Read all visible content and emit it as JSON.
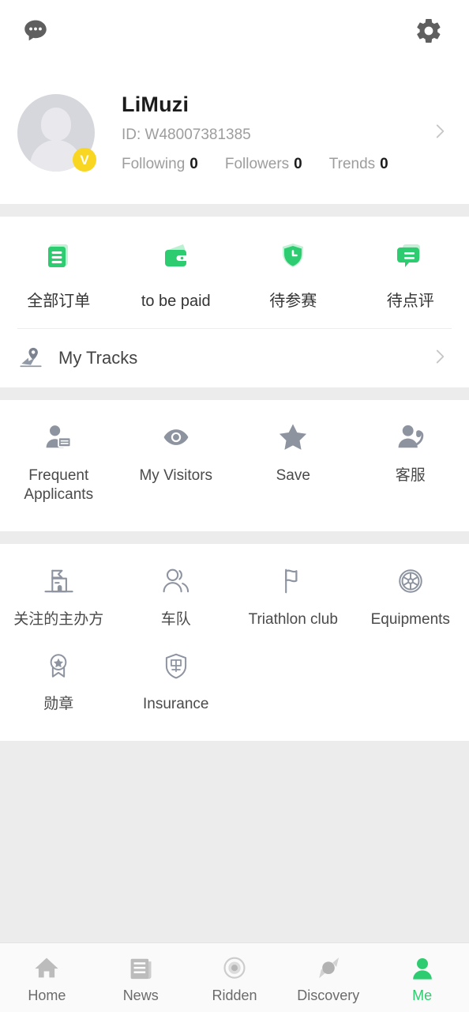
{
  "theme": {
    "accent_green": "#2ecc71",
    "badge_yellow": "#f8d621",
    "gray_icon": "#8d94a0",
    "page_bg": "#ececec"
  },
  "topbar": {
    "message_icon": "chat-bubble-icon",
    "settings_icon": "gear-icon"
  },
  "profile": {
    "name": "LiMuzi",
    "id": "ID: W48007381385",
    "verified_badge": "V",
    "avatar_icon": "default-avatar-placeholder",
    "chevron": "chevron-right-icon",
    "stats": [
      {
        "label": "Following",
        "value": "0"
      },
      {
        "label": "Followers",
        "value": "0"
      },
      {
        "label": "Trends",
        "value": "0"
      }
    ]
  },
  "orders": {
    "items": [
      {
        "label": "全部订单",
        "icon": "document-list-icon"
      },
      {
        "label": "to be paid",
        "icon": "wallet-icon"
      },
      {
        "label": "待参赛",
        "icon": "shield-clock-icon"
      },
      {
        "label": "待点评",
        "icon": "comment-bubble-icon"
      }
    ]
  },
  "tracks": {
    "label": "My Tracks",
    "icon": "map-pin-route-icon",
    "chevron": "chevron-right-icon"
  },
  "services": {
    "items": [
      {
        "label": "Frequent Applicants",
        "icon": "person-id-card-icon"
      },
      {
        "label": "My Visitors",
        "icon": "eye-icon"
      },
      {
        "label": "Save",
        "icon": "star-icon"
      },
      {
        "label": "客服",
        "icon": "person-headset-icon"
      }
    ]
  },
  "community": {
    "items": [
      {
        "label": "关注的主办方",
        "icon": "building-flag-icon"
      },
      {
        "label": "车队",
        "icon": "people-group-icon"
      },
      {
        "label": "Triathlon club",
        "icon": "flag-icon"
      },
      {
        "label": "Equipments",
        "icon": "bike-wheel-icon"
      },
      {
        "label": "勋章",
        "icon": "medal-badge-icon"
      },
      {
        "label": "Insurance",
        "icon": "shield-insurance-icon"
      }
    ]
  },
  "bottom_nav": {
    "items": [
      {
        "label": "Home",
        "icon": "home-icon",
        "active": false
      },
      {
        "label": "News",
        "icon": "news-icon",
        "active": false
      },
      {
        "label": "Ridden",
        "icon": "record-circle-icon",
        "active": false
      },
      {
        "label": "Discovery",
        "icon": "compass-icon",
        "active": false
      },
      {
        "label": "Me",
        "icon": "person-icon",
        "active": true
      }
    ]
  }
}
